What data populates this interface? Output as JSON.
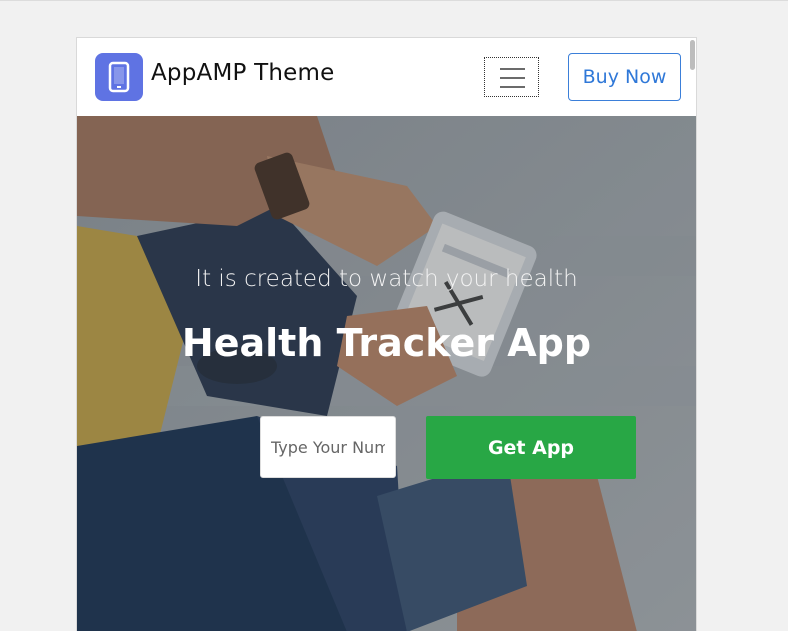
{
  "navbar": {
    "brand": "AppAMP Theme",
    "logo_icon": "smartphone-icon",
    "menu_icon": "hamburger-menu-icon",
    "buy_label": "Buy Now"
  },
  "hero": {
    "subtitle": "It is created to watch your health",
    "title": "Health Tracker App",
    "phone_placeholder": "Type Your Number",
    "get_app_label": "Get App"
  },
  "colors": {
    "logo_bg": "#5f73e3",
    "buy_accent": "#2f78d8",
    "cta_green": "#28a745"
  }
}
